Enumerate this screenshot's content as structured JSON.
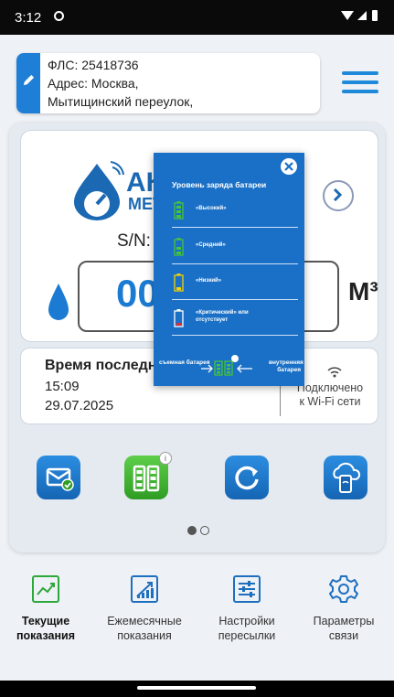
{
  "status": {
    "time": "3:12"
  },
  "account": {
    "fls": "ФЛС: 25418736",
    "address_line1": "Адрес: Москва,",
    "address_line2": "Мытищинский переулок,"
  },
  "meter": {
    "brand_top": "АКВ",
    "brand_bottom": "МЕТР",
    "sn_label": "S/N:",
    "value_partial": "00",
    "unit": "М³"
  },
  "last_reading": {
    "title": "Время последних показаний:",
    "time": "15:09",
    "date": "29.07.2025",
    "connection_line1": "Подключено",
    "connection_line2": "к Wi-Fi сети"
  },
  "battery_popup": {
    "title": "Уровень заряда батареи",
    "levels": [
      {
        "label": "«Высокий»",
        "color": "#45c43a"
      },
      {
        "label": "«Средний»",
        "color": "#45c43a"
      },
      {
        "label": "«Низкий»",
        "color": "#f2d400"
      },
      {
        "label": "«Критический» или отсутствует",
        "color": "#e42a2a"
      }
    ],
    "removable": "съемная батарея",
    "internal": "внутренняя батарея"
  },
  "pager": {
    "current": 1,
    "total": 2
  },
  "nav": [
    {
      "line1": "Текущие",
      "line2": "показания",
      "active": true
    },
    {
      "line1": "Ежемесячные",
      "line2": "показания",
      "active": false
    },
    {
      "line1": "Настройки",
      "line2": "пересылки",
      "active": false
    },
    {
      "line1": "Параметры",
      "line2": "связи",
      "active": false
    }
  ],
  "colors": {
    "accent": "#1f7fd6",
    "battery_green": "#3bb02f"
  }
}
